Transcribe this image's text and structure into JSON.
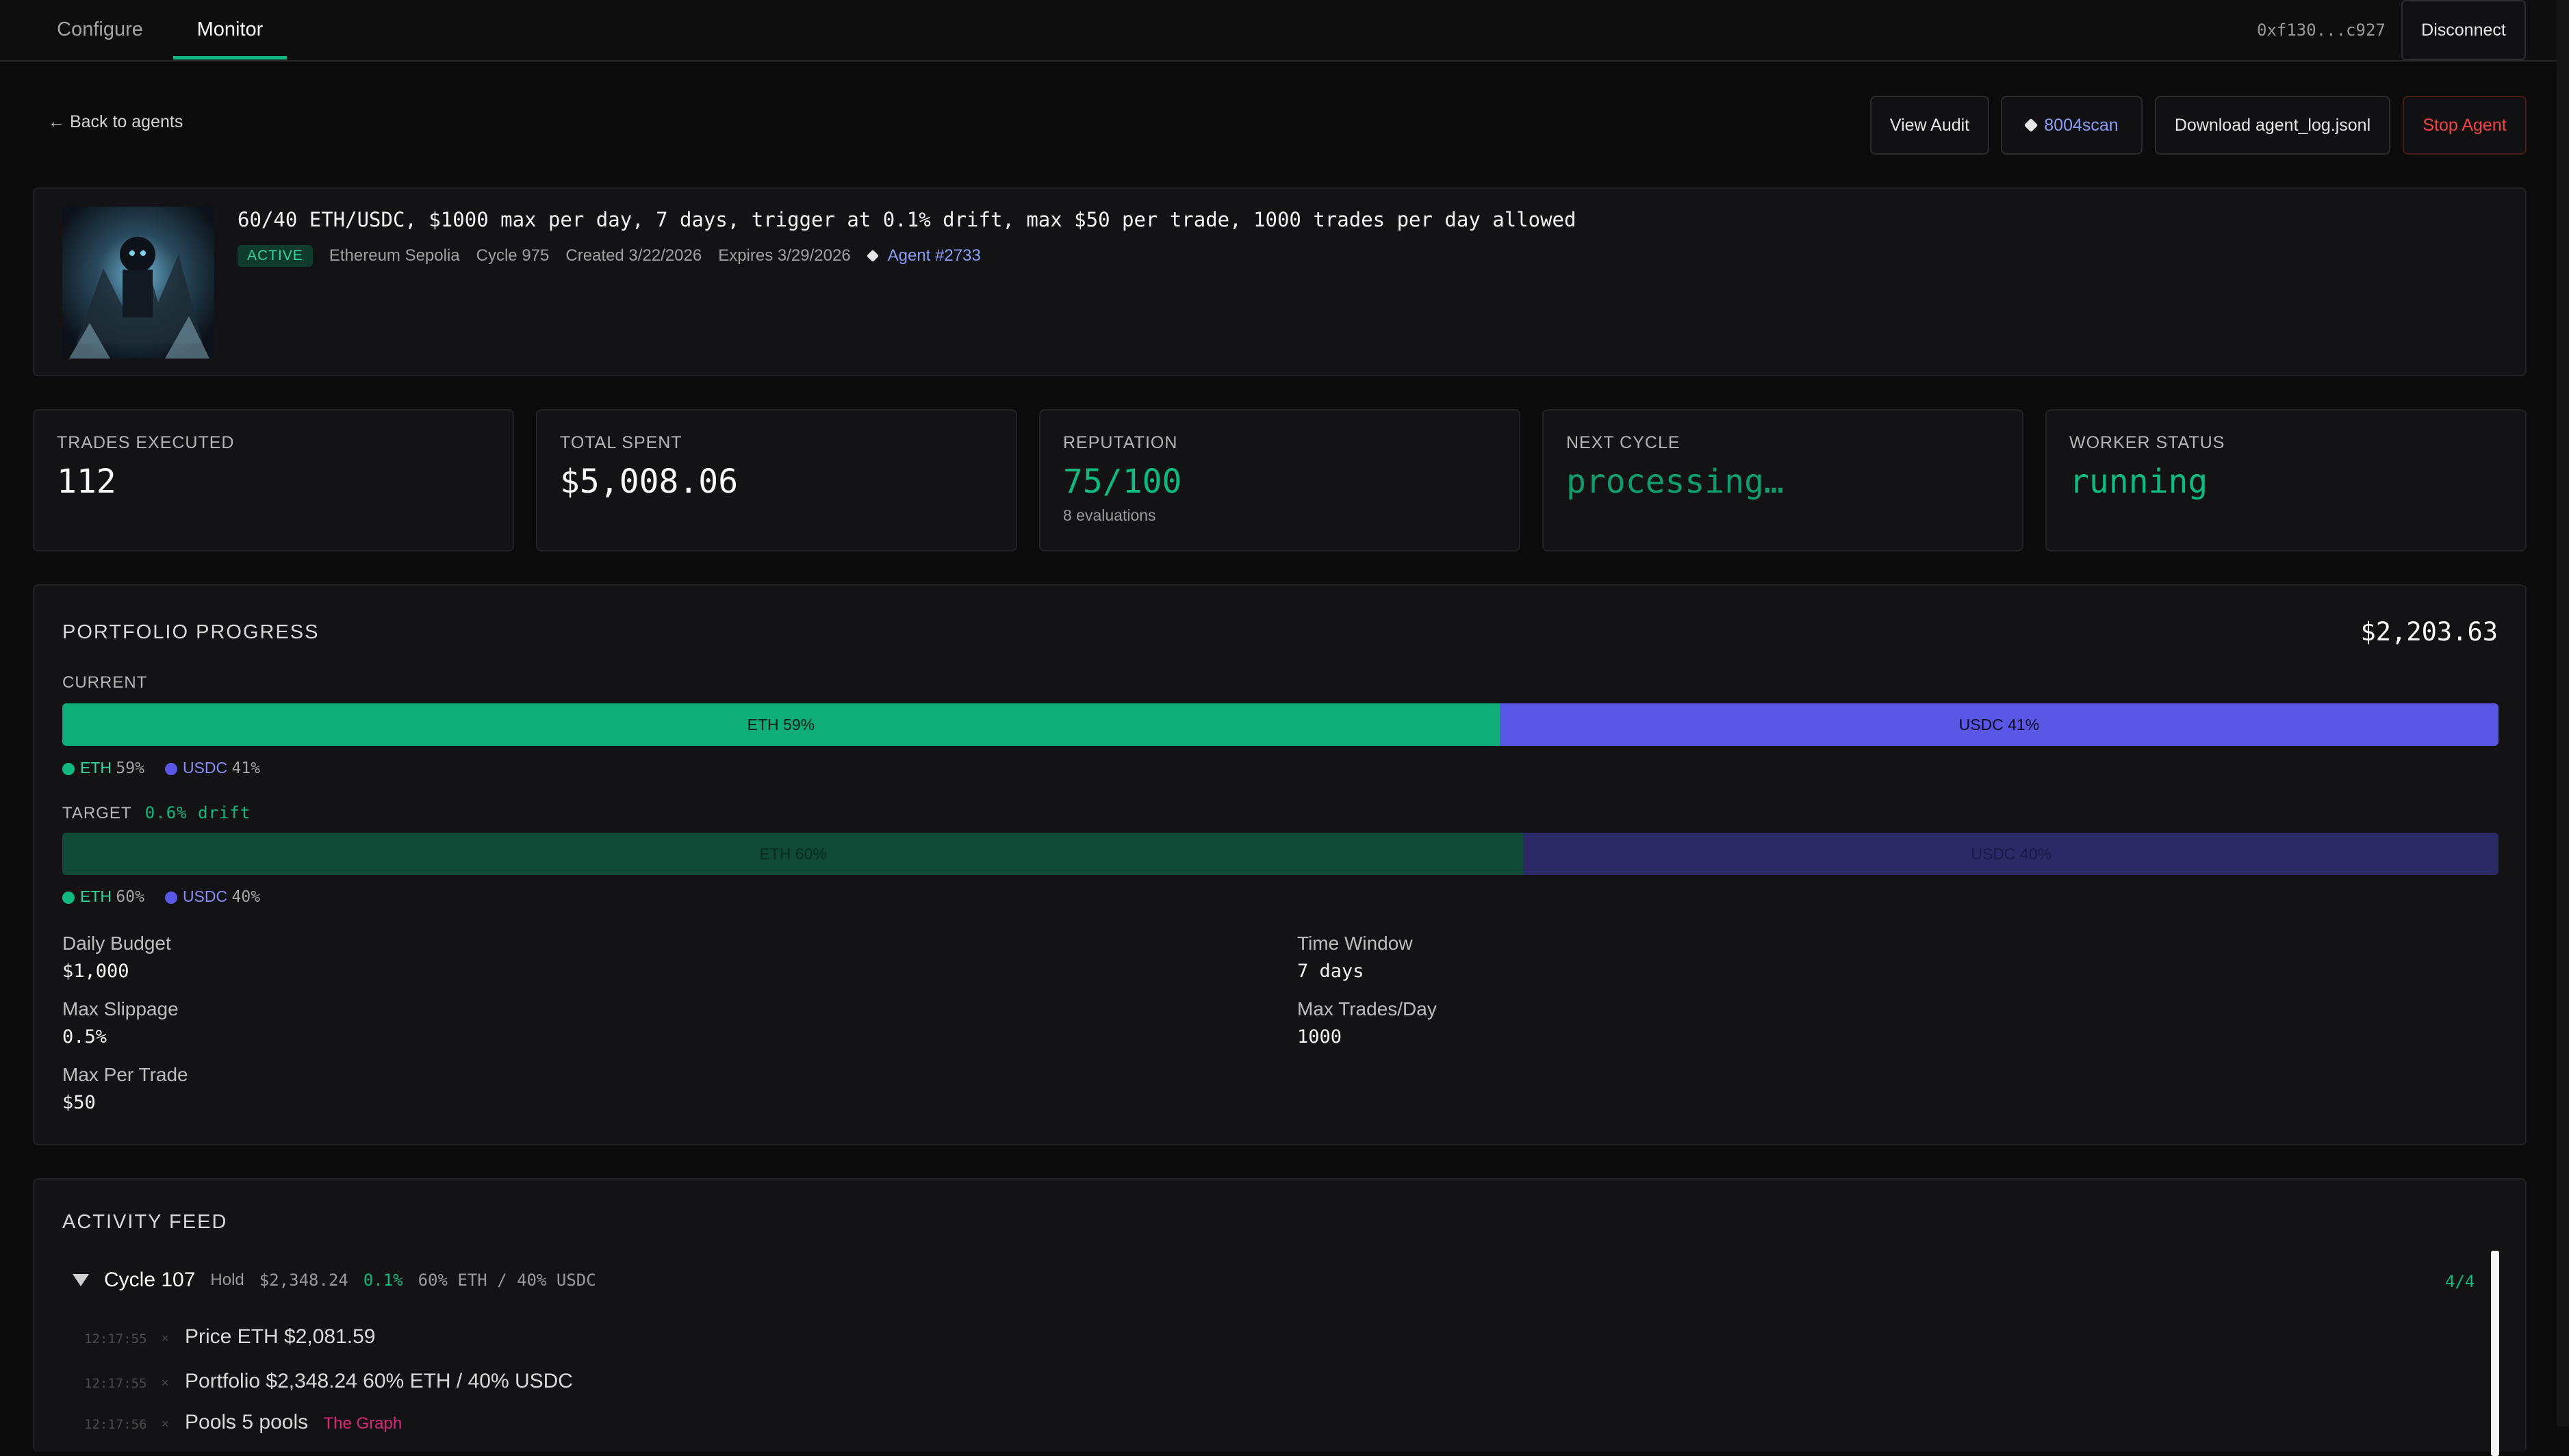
{
  "nav": {
    "tabs": [
      {
        "label": "Configure"
      },
      {
        "label": "Monitor"
      }
    ],
    "wallet_address": "0xf130...c927",
    "disconnect_label": "Disconnect"
  },
  "header": {
    "back_label": "← Back to agents",
    "actions": {
      "view_audit": "View Audit",
      "scan": "8004scan",
      "download": "Download agent_log.jsonl",
      "stop": "Stop Agent"
    }
  },
  "agent": {
    "description": "60/40 ETH/USDC, $1000 max per day, 7 days, trigger at 0.1% drift, max $50 per trade, 1000 trades per day allowed",
    "status": "ACTIVE",
    "network": "Ethereum Sepolia",
    "cycle": "Cycle 975",
    "created": "Created 3/22/2026",
    "expires": "Expires 3/29/2026",
    "agent_id": "Agent #2733"
  },
  "stats": [
    {
      "label": "TRADES EXECUTED",
      "value": "112",
      "sub": ""
    },
    {
      "label": "TOTAL SPENT",
      "value": "$5,008.06",
      "sub": ""
    },
    {
      "label": "REPUTATION",
      "value": "75/100",
      "sub": "8 evaluations"
    },
    {
      "label": "NEXT CYCLE",
      "value": "processing…",
      "sub": ""
    },
    {
      "label": "WORKER STATUS",
      "value": "running",
      "sub": ""
    }
  ],
  "portfolio": {
    "title": "PORTFOLIO PROGRESS",
    "total": "$2,203.63",
    "current_label": "CURRENT",
    "current": {
      "eth_label": "ETH 59%",
      "usdc_label": "USDC 41%",
      "eth_pct": 59,
      "usdc_pct": 41
    },
    "target_label": "TARGET",
    "drift": "0.6% drift",
    "target": {
      "eth_label": "ETH 60%",
      "usdc_label": "USDC 40%",
      "eth_pct": 60,
      "usdc_pct": 40
    },
    "legend_current": {
      "eth_name": "ETH",
      "eth_val": "59%",
      "usdc_name": "USDC",
      "usdc_val": "41%"
    },
    "legend_target": {
      "eth_name": "ETH",
      "eth_val": "60%",
      "usdc_name": "USDC",
      "usdc_val": "40%"
    },
    "colors": {
      "eth": "#0fae78",
      "usdc": "#5b57e6",
      "eth_target": "#0f4a36",
      "usdc_target": "#2b2a66"
    },
    "params": [
      {
        "key": "Daily Budget",
        "value": "$1,000"
      },
      {
        "key": "Time Window",
        "value": "7 days"
      },
      {
        "key": "Max Slippage",
        "value": "0.5%"
      },
      {
        "key": "Max Trades/Day",
        "value": "1000"
      },
      {
        "key": "Max Per Trade",
        "value": "$50"
      }
    ]
  },
  "activity": {
    "title": "ACTIVITY FEED",
    "cycle": {
      "name": "Cycle 107",
      "action": "Hold",
      "value": "$2,348.24",
      "drift": "0.1%",
      "alloc": "60% ETH / 40% USDC",
      "count": "4/4"
    },
    "logs": [
      {
        "time": "12:17:55",
        "text": "Price ETH $2,081.59",
        "source": ""
      },
      {
        "time": "12:17:55",
        "text": "Portfolio $2,348.24 60% ETH / 40% USDC",
        "source": ""
      },
      {
        "time": "12:17:56",
        "text": "Pools 5 pools",
        "source": "The Graph"
      }
    ]
  }
}
